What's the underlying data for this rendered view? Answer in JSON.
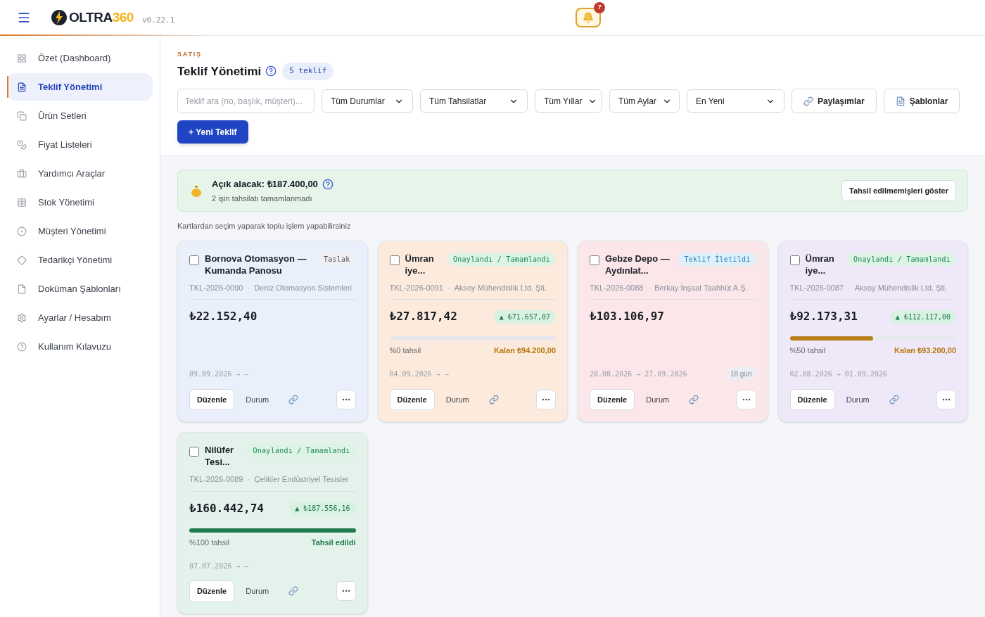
{
  "header": {
    "logo": {
      "first": "OLTRA",
      "second": "360"
    },
    "version": "v0.22.1",
    "notifications": {
      "count": "7"
    }
  },
  "sidebar": {
    "items": [
      {
        "label": "Özet (Dashboard)",
        "selected": false
      },
      {
        "label": "Teklif Yönetimi",
        "selected": true
      },
      {
        "label": "Ürün Setleri",
        "selected": false
      },
      {
        "label": "Fiyat Listeleri",
        "selected": false
      },
      {
        "label": "Yardımcı Araçlar",
        "selected": false
      },
      {
        "label": "Stok Yönetimi",
        "selected": false
      },
      {
        "label": "Müşteri Yönetimi",
        "selected": false
      },
      {
        "label": "Tedarikçi Yönetimi",
        "selected": false
      },
      {
        "label": "Doküman Şablonları",
        "selected": false
      },
      {
        "label": "Ayarlar / Hesabım",
        "selected": false
      },
      {
        "label": "Kullanım Kılavuzu",
        "selected": false
      }
    ]
  },
  "page": {
    "section": "SATIŞ",
    "title": "Teklif Yönetimi",
    "count_badge": "5 teklif"
  },
  "toolbar": {
    "search": {
      "placeholder": "Teklif ara (no, başlık, müşteri)..."
    },
    "filters": [
      "Tüm Durumlar",
      "Tüm Tahsilatlar",
      "Tüm Yıllar",
      "Tüm Aylar",
      "En Yeni"
    ],
    "buttons": [
      "Paylaşımlar",
      "Şablonlar"
    ],
    "new_button": "+ Yeni Teklif"
  },
  "receivables": {
    "title": "Açık alacak: ₺187.400,00",
    "subtitle": "2 işin tahsilatı tamamlanmadı",
    "button": "Tahsil edilmemişleri göster"
  },
  "hint": "Kartlardan seçim yaparak toplu işlem yapabilirsiniz",
  "cards": [
    {
      "color": "#eaf0fb",
      "checked": false,
      "title": "Bornova Otomasyon — Kumanda Panosu",
      "status": {
        "label": "Taslak",
        "kind": "draft"
      },
      "number": "TKL-2026-0090",
      "separator": "·",
      "customer": "Deniz Otomasyon Sistemleri",
      "amount": "₺22.152,40",
      "dates": "09.09.2026 → —",
      "actions": {
        "edit": "Düzenle",
        "status": "Durum"
      }
    },
    {
      "color": "#fcebdd",
      "checked": false,
      "title": "Ümran iye...",
      "status": {
        "label": "Onaylandı / Tamamlandı",
        "kind": "approved"
      },
      "number": "TKL-2026-0091",
      "separator": "·",
      "customer": "Aksoy Mühendislik Ltd. Şti.",
      "amount": "₺27.817,42",
      "delta": "▲ ₺71.657,07",
      "payment": {
        "level": 0,
        "collected": "%0 tahsil",
        "remaining": "Kalan ₺94.200,00",
        "kind": "partial"
      },
      "dates": "04.09.2026 → —",
      "actions": {
        "edit": "Düzenle",
        "status": "Durum"
      }
    },
    {
      "color": "#fbe6ea",
      "checked": false,
      "title": "Gebze Depo — Aydınlat...",
      "status": {
        "label": "Teklif İletildi",
        "kind": "sent"
      },
      "number": "TKL-2026-0088",
      "separator": "·",
      "customer": "Berkay İnşaat Taahhüt A.Ş.",
      "amount": "₺103.106,97",
      "dates": "28.08.2026 → 27.09.2026",
      "days": "18 gün",
      "actions": {
        "edit": "Düzenle",
        "status": "Durum"
      }
    },
    {
      "color": "#efe8f8",
      "checked": false,
      "title": "Ümran iye...",
      "status": {
        "label": "Onaylandı / Tamamlandı",
        "kind": "approved"
      },
      "number": "TKL-2026-0087",
      "separator": "·",
      "customer": "Aksoy Mühendislik Ltd. Şti.",
      "amount": "₺92.173,31",
      "delta": "▲ ₺112.117,00",
      "payment": {
        "level": 0.5,
        "collected": "%50 tahsil",
        "remaining": "Kalan ₺93.200,00",
        "kind": "partial"
      },
      "dates": "02.08.2026 → 01.09.2026",
      "actions": {
        "edit": "Düzenle",
        "status": "Durum"
      }
    },
    {
      "color": "#e3f3ec",
      "checked": false,
      "title": "Nilüfer Tesi...",
      "status": {
        "label": "Onaylandı / Tamamlandı",
        "kind": "approved"
      },
      "number": "TKL-2026-0089",
      "separator": "·",
      "customer": "Çelikler Endüstriyel Tesisler",
      "amount": "₺160.442,74",
      "delta": "▲ ₺187.556,16",
      "payment": {
        "level": 1,
        "collected": "%100 tahsil",
        "remaining": "Tahsil edildi",
        "kind": "complete"
      },
      "dates": "07.07.2026 → —",
      "actions": {
        "edit": "Düzenle",
        "status": "Durum"
      }
    }
  ]
}
